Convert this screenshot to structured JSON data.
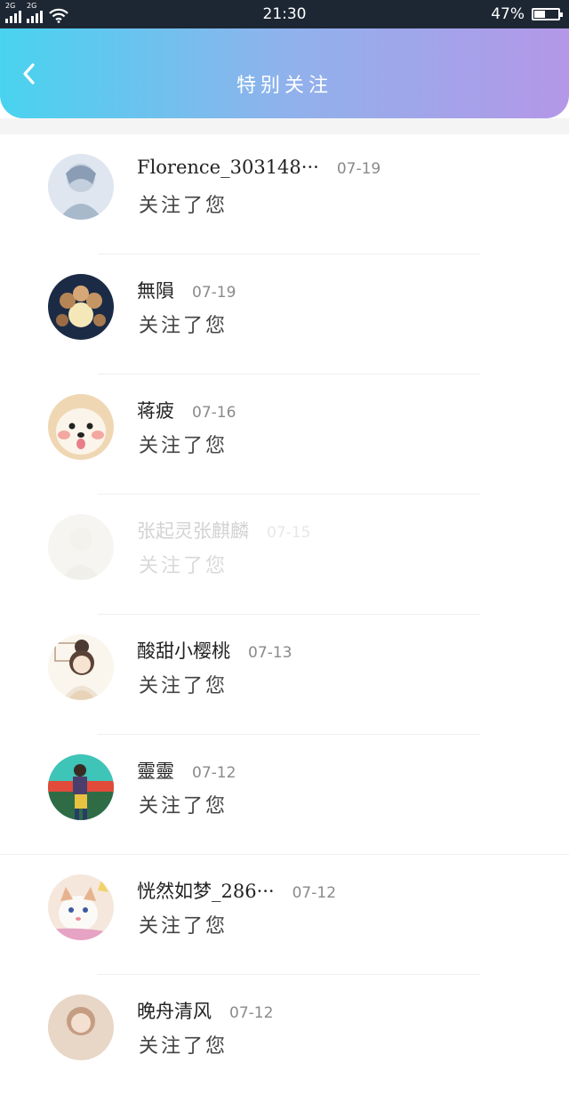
{
  "status_bar": {
    "network_1": "2G",
    "network_2": "2G",
    "time": "21:30",
    "battery_percent": "47%",
    "battery_level": 0.47
  },
  "header": {
    "back_icon": "chevron-left-icon",
    "title": "特别关注"
  },
  "colors": {
    "gradient_start": "#48d3ef",
    "gradient_end": "#b497e8",
    "status_bar_bg": "#1d2733"
  },
  "items": [
    {
      "name": "Florence_303148···",
      "date": "07-19",
      "action": "关注了您"
    },
    {
      "name": "無隕",
      "date": "07-19",
      "action": "关注了您"
    },
    {
      "name": "蒋疲",
      "date": "07-16",
      "action": "关注了您"
    },
    {
      "name": "张起灵张麒麟",
      "date": "07-15",
      "action": "关注了您"
    },
    {
      "name": "酸甜小樱桃",
      "date": "07-13",
      "action": "关注了您"
    },
    {
      "name": "靈靈",
      "date": "07-12",
      "action": "关注了您"
    },
    {
      "name": "恍然如梦_286···",
      "date": "07-12",
      "action": "关注了您"
    },
    {
      "name": "晚舟清风",
      "date": "07-12",
      "action": "关注了您"
    }
  ]
}
